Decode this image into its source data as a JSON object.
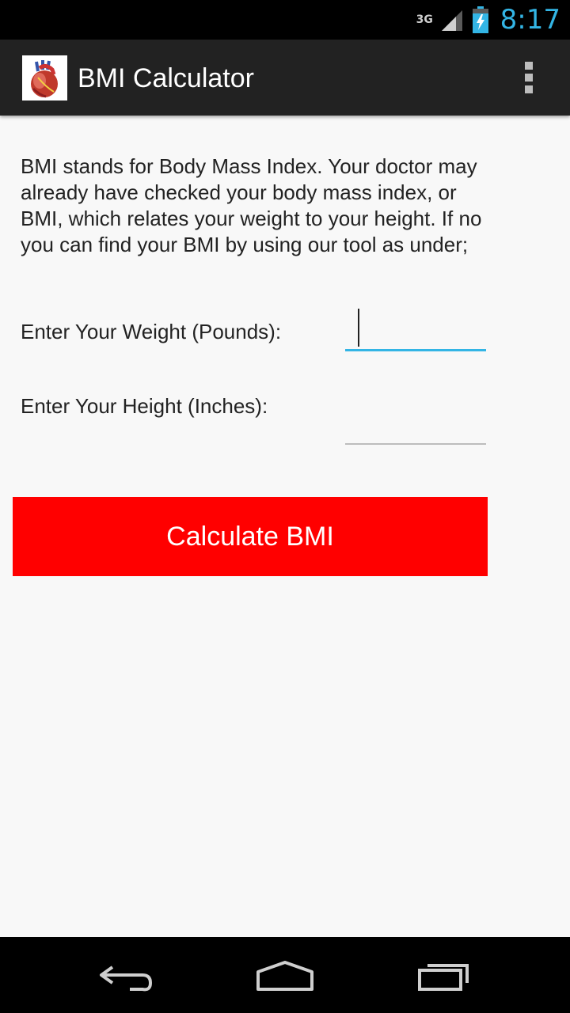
{
  "status_bar": {
    "network": "3G",
    "time": "8:17",
    "icons": [
      "signal-icon",
      "battery-charging-icon"
    ],
    "clock_color": "#33b5e5"
  },
  "action_bar": {
    "title": "BMI Calculator",
    "app_icon": "heart-icon",
    "menu_icon": "overflow-menu-icon"
  },
  "main": {
    "intro_text": "BMI stands for Body Mass Index. Your doctor may already have checked your body mass index, or BMI, which relates your weight to your height. If no you can find your BMI by using our tool as under;",
    "weight": {
      "label": "Enter Your Weight (Pounds):",
      "value": ""
    },
    "height": {
      "label": "Enter Your Height (Inches):",
      "value": ""
    },
    "button_label": "Calculate BMI",
    "button_color": "#ff0000",
    "focus_color": "#33b5e5"
  },
  "nav_bar": {
    "icons": [
      "back-icon",
      "home-icon",
      "recent-apps-icon"
    ]
  }
}
